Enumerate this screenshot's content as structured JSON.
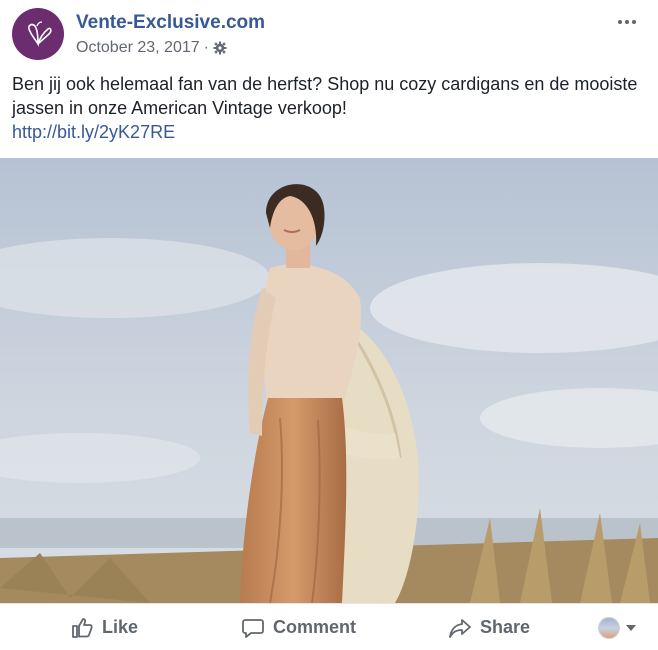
{
  "post": {
    "page_name": "Vente-Exclusive.com",
    "date": "October 23, 2017",
    "separator": "·",
    "text": "Ben jij ook helemaal fan van de herfst? Shop nu cozy cardigans en de mooiste jassen in onze American Vintage verkoop!",
    "link": "http://bit.ly/2yK27RE"
  },
  "actions": {
    "like_label": "Like",
    "comment_label": "Comment",
    "share_label": "Share"
  },
  "icons": {
    "avatar": "butterfly-logo-icon",
    "audience": "globe-icon",
    "settings": "gear-icon",
    "more": "more-options-icon",
    "like": "thumbs-up-icon",
    "comment": "speech-bubble-icon",
    "share": "share-arrow-icon"
  },
  "colors": {
    "brand": "#6b2d6e",
    "link": "#385898",
    "text": "#1d2129",
    "muted": "#606770"
  }
}
